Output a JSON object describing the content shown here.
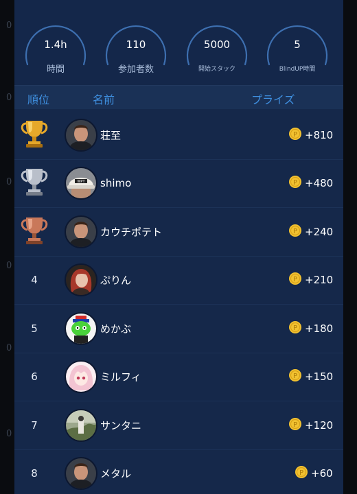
{
  "edge_marks": [
    "0",
    "0",
    "0",
    "0",
    "0",
    "0"
  ],
  "stats": [
    {
      "value": "1.4h",
      "label": "時間"
    },
    {
      "value": "110",
      "label": "参加者数"
    },
    {
      "value": "5000",
      "label": "開始スタック"
    },
    {
      "value": "5",
      "label": "BlindUP時間"
    }
  ],
  "header": {
    "rank": "順位",
    "name": "名前",
    "prize": "プライズ"
  },
  "rows": [
    {
      "rank": "1",
      "trophy": "gold-trophy-icon",
      "avatar": "man-portrait",
      "name": "荘至",
      "prize": "+810"
    },
    {
      "rank": "2",
      "trophy": "silver-trophy-icon",
      "avatar": "wpt-cap",
      "name": "shimo",
      "prize": "+480"
    },
    {
      "rank": "3",
      "trophy": "bronze-trophy-icon",
      "avatar": "man-portrait",
      "name": "カウチポテト",
      "prize": "+240"
    },
    {
      "rank": "4",
      "avatar": "red-hair-woman",
      "name": "ぷりん",
      "prize": "+210"
    },
    {
      "rank": "5",
      "avatar": "green-cartoon",
      "name": "めかぶ",
      "prize": "+180"
    },
    {
      "rank": "6",
      "avatar": "anime-girl",
      "name": "ミルフィ",
      "prize": "+150"
    },
    {
      "rank": "7",
      "avatar": "outdoor-photo",
      "name": "サンタニ",
      "prize": "+120"
    },
    {
      "rank": "8",
      "avatar": "man-portrait",
      "name": "メタル",
      "prize": "+60"
    }
  ],
  "colors": {
    "panel": "#15284a",
    "header_text": "#3f8fdf",
    "gauge_ring": "#3d6fb0",
    "coin": "#f2c230",
    "gold": "#e5a82a",
    "silver": "#b9bfca",
    "bronze": "#c9785a"
  }
}
